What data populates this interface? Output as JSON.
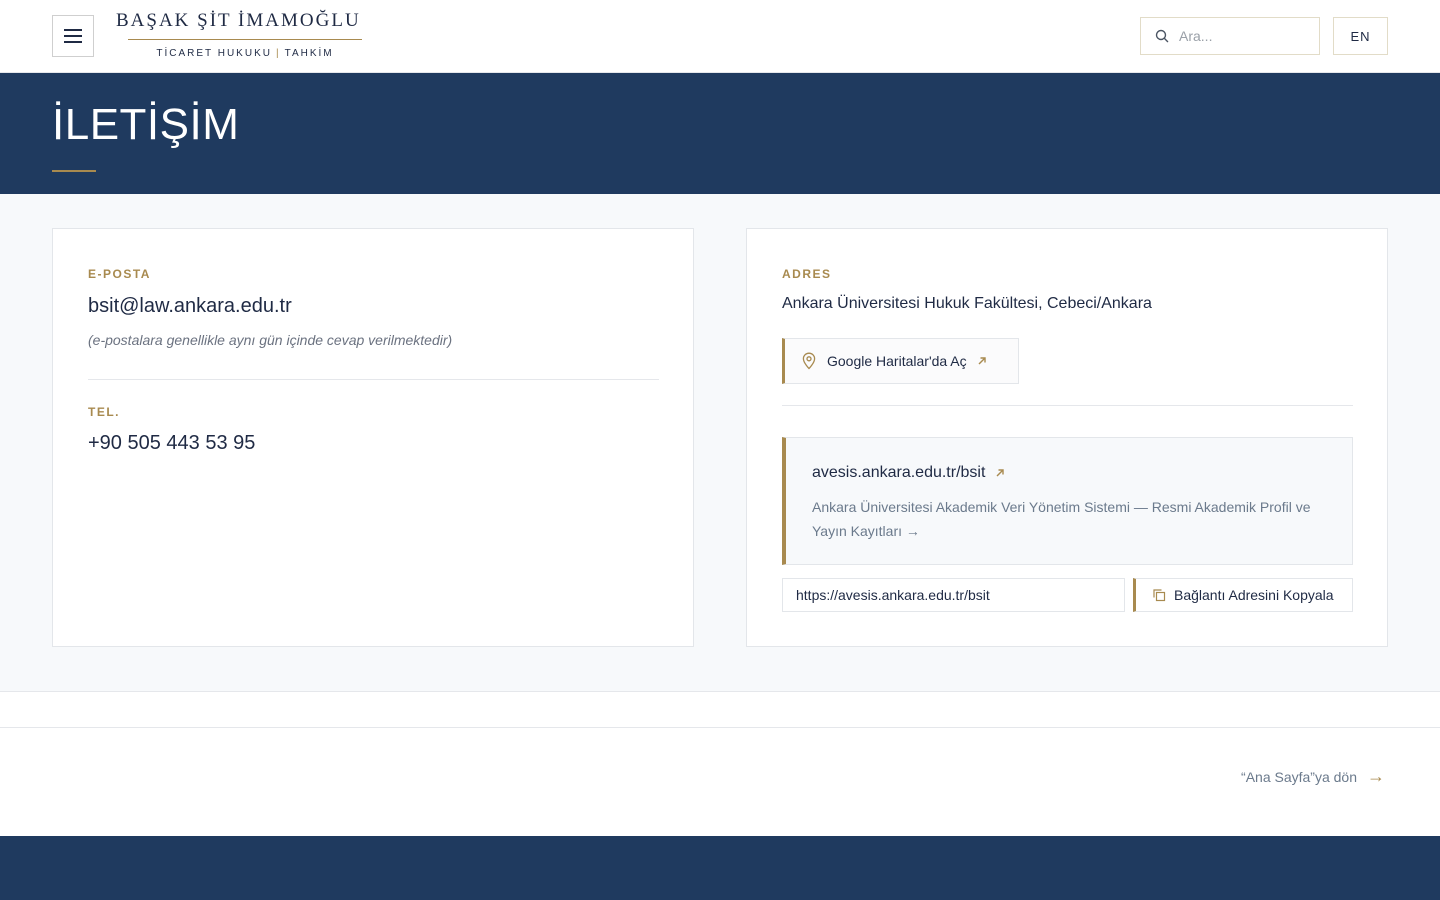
{
  "header": {
    "brand_name": "BAŞAK ŞİT İMAMOĞLU",
    "brand_tag_left": "TİCARET HUKUKU",
    "brand_tag_sep": "|",
    "brand_tag_right": "TAHKİM",
    "search_placeholder": "Ara...",
    "lang_label": "EN"
  },
  "hero": {
    "title": "İLETİŞİM"
  },
  "contact": {
    "email_label": "E-POSTA",
    "email_value": "bsit@law.ankara.edu.tr",
    "email_note": "(e-postalara genellikle aynı gün içinde cevap verilmektedir)",
    "tel_label": "TEL.",
    "tel_value": "+90 505 443 53 95"
  },
  "address": {
    "label": "ADRES",
    "value": "Ankara Üniversitesi Hukuk Fakültesi, Cebeci/Ankara",
    "map_button_label": "Google Haritalar'da Aç"
  },
  "profile_link": {
    "title": "avesis.ankara.edu.tr/bsit",
    "description": "Ankara Üniversitesi Akademik Veri Yönetim Sistemi — Resmi Akademik Profil ve Yayın Kayıtları →",
    "url_value": "https://avesis.ankara.edu.tr/bsit",
    "copy_button_label": "Bağlantı Adresini Kopyala"
  },
  "back": {
    "label": "“Ana Sayfa”ya dön",
    "arrow": "→"
  },
  "colors": {
    "navy": "#1f3a5f",
    "gold": "#a88a4f",
    "background": "#f7f9fb"
  },
  "icons": {
    "menu": "hamburger-menu-icon",
    "search": "search-icon",
    "map": "map-pin-icon",
    "external": "external-arrow-icon",
    "copy": "copy-icon"
  }
}
